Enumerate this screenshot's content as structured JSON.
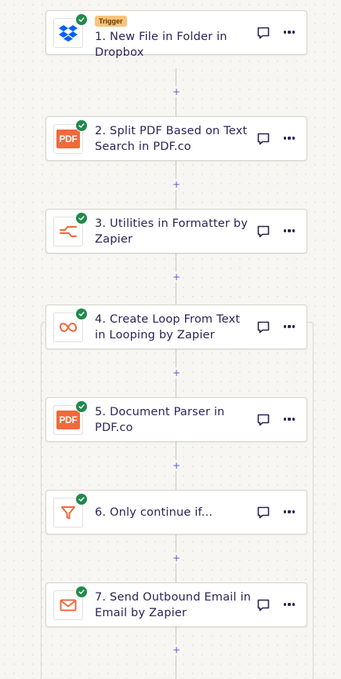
{
  "steps": [
    {
      "number": "1",
      "title": "1. New File in Folder in Dropbox",
      "badge": "Trigger",
      "app": "Dropbox",
      "icon": "dropbox-icon",
      "status": "complete"
    },
    {
      "number": "2",
      "title": "2. Split PDF Based on Text Search in PDF.co",
      "app": "PDF.co",
      "icon": "pdf-icon",
      "icon_text": "PDF",
      "status": "complete"
    },
    {
      "number": "3",
      "title": "3. Utilities in Formatter by Zapier",
      "app": "Formatter by Zapier",
      "icon": "formatter-icon",
      "status": "complete"
    },
    {
      "number": "4",
      "title": "4. Create Loop From Text in Looping by Zapier",
      "app": "Looping by Zapier",
      "icon": "loop-icon",
      "status": "complete"
    },
    {
      "number": "5",
      "title": "5. Document Parser in PDF.co",
      "app": "PDF.co",
      "icon": "pdf-icon",
      "icon_text": "PDF",
      "status": "complete"
    },
    {
      "number": "6",
      "title": "6. Only continue if...",
      "app": "Filter by Zapier",
      "icon": "filter-icon",
      "status": "complete"
    },
    {
      "number": "7",
      "title": "7. Send Outbound Email in Email by Zapier",
      "app": "Email by Zapier",
      "icon": "email-icon",
      "status": "complete"
    }
  ],
  "add_step_label": "+",
  "colors": {
    "accent_orange": "#ef6a3b",
    "dropbox_blue": "#0061fe",
    "check_green": "#1f8a4c",
    "trigger_badge": "#fbc376",
    "text": "#2b2358",
    "plus": "#5a5ad6"
  }
}
